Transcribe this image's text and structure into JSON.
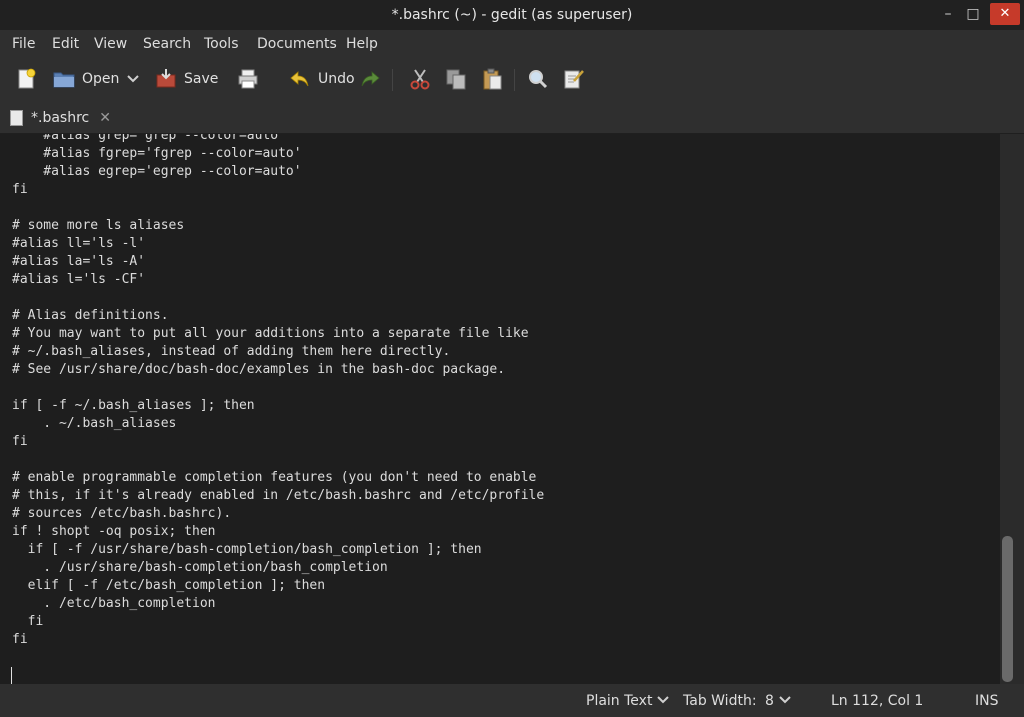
{
  "window": {
    "title": "*.bashrc (~) - gedit (as superuser)",
    "min_glyph": "–",
    "max_glyph": "□",
    "close_glyph": "✕"
  },
  "menubar": {
    "items": [
      "File",
      "Edit",
      "View",
      "Search",
      "Tools",
      "Documents",
      "Help"
    ]
  },
  "toolbar": {
    "new_icon": "new-document-icon",
    "open_label": "Open",
    "open_dropdown_icon": "chevron-down-icon",
    "save_label": "Save",
    "print_icon": "print-icon",
    "undo_label": "Undo",
    "redo_icon": "redo-icon",
    "cut_icon": "cut-icon",
    "copy_icon": "copy-icon",
    "paste_icon": "paste-icon",
    "find_icon": "search-icon",
    "replace_icon": "find-replace-icon"
  },
  "tab": {
    "label": "*.bashrc",
    "close_glyph": "✕"
  },
  "editor": {
    "lines": [
      "    #alias grep='grep --color=auto'",
      "    #alias fgrep='fgrep --color=auto'",
      "    #alias egrep='egrep --color=auto'",
      "fi",
      "",
      "# some more ls aliases",
      "#alias ll='ls -l'",
      "#alias la='ls -A'",
      "#alias l='ls -CF'",
      "",
      "# Alias definitions.",
      "# You may want to put all your additions into a separate file like",
      "# ~/.bash_aliases, instead of adding them here directly.",
      "# See /usr/share/doc/bash-doc/examples in the bash-doc package.",
      "",
      "if [ -f ~/.bash_aliases ]; then",
      "    . ~/.bash_aliases",
      "fi",
      "",
      "# enable programmable completion features (you don't need to enable",
      "# this, if it's already enabled in /etc/bash.bashrc and /etc/profile",
      "# sources /etc/bash.bashrc).",
      "if ! shopt -oq posix; then",
      "  if [ -f /usr/share/bash-completion/bash_completion ]; then",
      "    . /usr/share/bash-completion/bash_completion",
      "  elif [ -f /etc/bash_completion ]; then",
      "    . /etc/bash_completion",
      "  fi",
      "fi",
      "",
      ""
    ]
  },
  "statusbar": {
    "language": "Plain Text",
    "tab_width_label": "Tab Width:",
    "tab_width_value": "8",
    "position": "Ln 112, Col 1",
    "mode": "INS"
  }
}
